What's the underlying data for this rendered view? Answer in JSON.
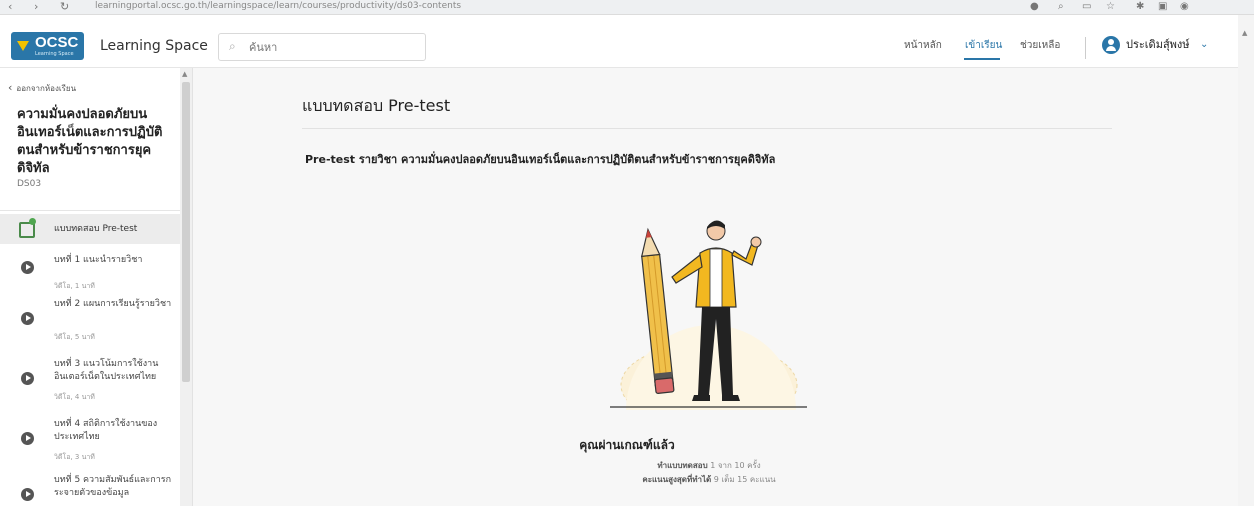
{
  "browser": {
    "back": "‹",
    "forward": "›",
    "reload": "↻",
    "url": "learningportal.ocsc.go.th/learningspace/learn/courses/productivity/ds03-contents"
  },
  "header": {
    "logo_text": "OCSC",
    "logo_sub": "Learning Space",
    "app_name": "Learning Space",
    "search_placeholder": "ค้นหา",
    "nav": [
      "หน้าหลัก",
      "เข้าเรียน",
      "ช่วยเหลือ"
    ],
    "user_name": "ประเดิมสุ์พงษ์",
    "chevron": "⌄",
    "accent_color": "#2a76a8"
  },
  "sidebar": {
    "back_label": "ออกจากห้องเรียน",
    "course_title": "ความมั่นคงปลอดภัยบนอินเทอร์เน็ตและการปฏิบัติตนสำหรับข้าราชการยุคดิจิทัล",
    "course_code": "DS03",
    "active_item": "แบบทดสอบ Pre-test",
    "lessons": [
      {
        "title": "บทที่ 1 แนะนำรายวิชา",
        "meta": "วิดีโอ, 1 นาที"
      },
      {
        "title": "บทที่ 2 แผนการเรียนรู้รายวิชา",
        "meta": "วิดีโอ, 5 นาที"
      },
      {
        "title": "บทที่ 3 แนวโน้มการใช้งานอินเตอร์เน็ตในประเทศไทย",
        "meta": "วิดีโอ, 4 นาที"
      },
      {
        "title": "บทที่ 4 สถิติการใช้งานของประเทศไทย",
        "meta": "วิดีโอ, 3 นาที"
      },
      {
        "title": "บทที่ 5 ความสัมพันธ์และการกระจายตัวของข้อมูล",
        "meta": ""
      }
    ]
  },
  "main": {
    "heading": "แบบทดสอบ Pre-test",
    "subject": "Pre-test รายวิชา ความมั่นคงปลอดภัยบนอินเทอร์เน็ตและการปฏิบัติตนสำหรับข้าราชการยุคดิจิทัล",
    "pass_text": "คุณผ่านเกณฑ์แล้ว",
    "attempts_label": "ทำแบบทดสอบ",
    "attempts_value": "1 จาก 10 ครั้ง",
    "score_label": "คะแนนสูงสุดที่ทำได้",
    "score_value": "9 เต็ม 15 คะแนน"
  }
}
